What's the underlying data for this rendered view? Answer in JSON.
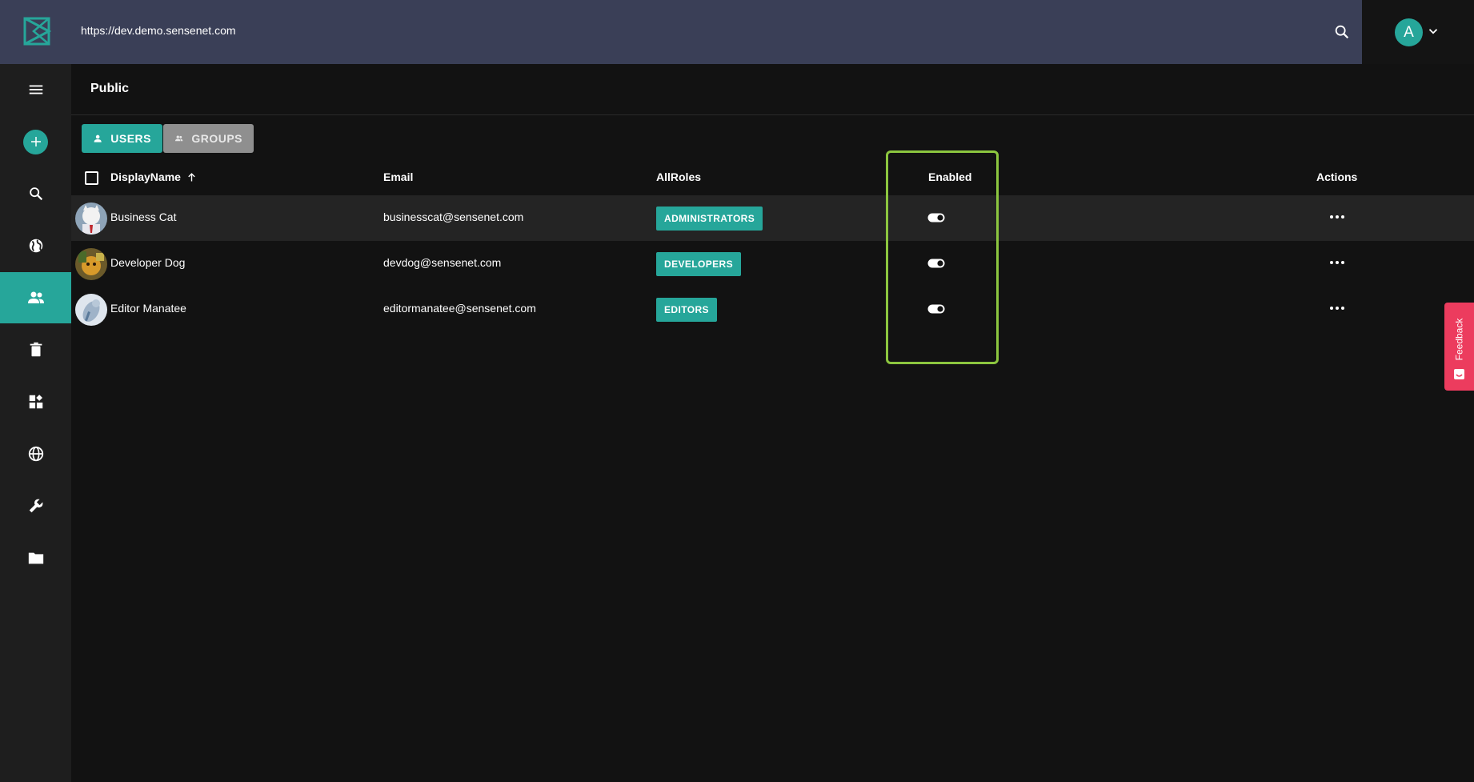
{
  "header": {
    "url": "https://dev.demo.sensenet.com",
    "avatar_letter": "A",
    "logo_icon": "sensenet-logo-icon",
    "search_icon": "search-icon",
    "chevron_icon": "chevron-down-icon"
  },
  "sidebar": {
    "items": [
      {
        "name": "menu",
        "icon": "hamburger-menu-icon"
      },
      {
        "name": "add",
        "icon": "plus-icon"
      },
      {
        "name": "search",
        "icon": "search-icon"
      },
      {
        "name": "content",
        "icon": "globe-icon"
      },
      {
        "name": "users-and-groups",
        "icon": "people-icon",
        "active": true
      },
      {
        "name": "trash",
        "icon": "trash-icon"
      },
      {
        "name": "content-types",
        "icon": "widgets-icon"
      },
      {
        "name": "localization",
        "icon": "language-icon"
      },
      {
        "name": "setup",
        "icon": "wrench-icon"
      },
      {
        "name": "files",
        "icon": "folder-icon"
      }
    ]
  },
  "page": {
    "title": "Public",
    "tabs": [
      {
        "label": "USERS",
        "icon": "person-icon",
        "active": true
      },
      {
        "label": "GROUPS",
        "icon": "people-icon",
        "active": false
      }
    ]
  },
  "table": {
    "columns": {
      "displayname": "DisplayName",
      "email": "Email",
      "allroles": "AllRoles",
      "enabled": "Enabled",
      "actions": "Actions"
    },
    "sort_icon": "arrow-up-icon",
    "rows": [
      {
        "name": "Business Cat",
        "email": "businesscat@sensenet.com",
        "role": "ADMINISTRATORS",
        "enabled": true
      },
      {
        "name": "Developer Dog",
        "email": "devdog@sensenet.com",
        "role": "DEVELOPERS",
        "enabled": true
      },
      {
        "name": "Editor Manatee",
        "email": "editormanatee@sensenet.com",
        "role": "EDITORS",
        "enabled": true
      }
    ]
  },
  "feedback": {
    "label": "Feedback",
    "color": "#ec3c5e"
  },
  "colors": {
    "accent": "#26a69a",
    "topbar": "#3a3f57",
    "highlight": "#8cc63f"
  }
}
